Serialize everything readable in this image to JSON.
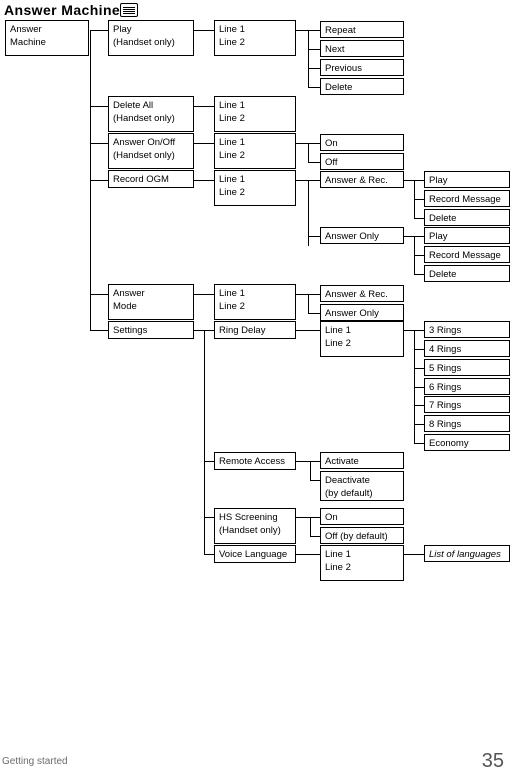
{
  "page": {
    "title": "Answer Machine",
    "title_icon": "answer-machine-icon",
    "footer_left": "Getting started",
    "footer_page_number": "35"
  },
  "nodes": {
    "root": "Answer\nMachine",
    "level1": [
      {
        "id": "play",
        "label": "Play\n(Handset only)"
      },
      {
        "id": "delete-all",
        "label": "Delete All\n(Handset only)"
      },
      {
        "id": "answer-on-off",
        "label": "Answer On/Off\n(Handset only)"
      },
      {
        "id": "record-ogm",
        "label": "Record OGM"
      },
      {
        "id": "answer-mode",
        "label": "Answer\nMode"
      },
      {
        "id": "settings",
        "label": "Settings"
      }
    ],
    "play_lines": "Line 1\nLine 2",
    "play_actions": [
      "Repeat",
      "Next",
      "Previous",
      "Delete"
    ],
    "delete_all_lines": "Line 1\nLine 2",
    "answer_on_off_lines": "Line 1\nLine 2",
    "answer_on_off_values": [
      "On",
      "Off"
    ],
    "record_ogm_lines": "Line 1\nLine 2",
    "record_ogm_modes": [
      {
        "label": "Answer & Rec.",
        "actions": [
          "Play",
          "Record Message",
          "Delete"
        ]
      },
      {
        "label": "Answer Only",
        "actions": [
          "Play",
          "Record Message",
          "Delete"
        ]
      }
    ],
    "answer_mode_lines": "Line 1\nLine 2",
    "answer_mode_values": [
      "Answer & Rec.",
      "Answer Only"
    ],
    "settings": [
      {
        "id": "ring-delay",
        "label": "Ring Delay"
      },
      {
        "id": "remote-access",
        "label": "Remote  Access"
      },
      {
        "id": "hs-screening",
        "label": "HS Screening\n(Handset only)"
      },
      {
        "id": "voice-language",
        "label": "Voice Language"
      }
    ],
    "ring_delay_lines": "Line 1\nLine 2",
    "ring_delay_values": [
      "3 Rings",
      "4 Rings",
      "5 Rings",
      "6 Rings",
      "7 Rings",
      "8 Rings",
      "Economy"
    ],
    "remote_access_values": [
      "Activate",
      "Deactivate\n(by default)"
    ],
    "hs_screening_values": [
      "On",
      "Off (by default)"
    ],
    "voice_language_lines": "Line 1\nLine 2",
    "voice_language_values": [
      "List of languages"
    ]
  }
}
